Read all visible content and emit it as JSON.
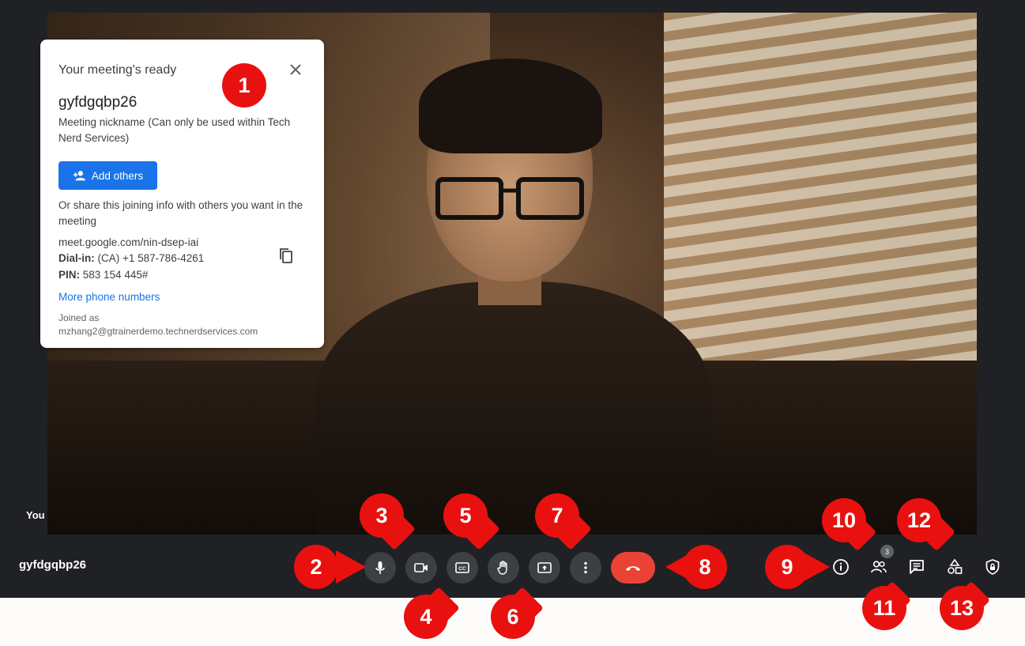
{
  "video": {
    "self_label": "You"
  },
  "meeting_card": {
    "title": "Your meeting's ready",
    "code": "gyfdgqbp26",
    "nickname_note": "Meeting nickname (Can only be used within Tech Nerd Services)",
    "add_others_label": "Add others",
    "share_text": "Or share this joining info with others you want in the meeting",
    "meeting_link": "meet.google.com/nin-dsep-iai",
    "dial_in_label": "Dial-in:",
    "dial_in_value": "(CA) +1 587-786-4261",
    "pin_label": "PIN:",
    "pin_value": "583 154 445#",
    "more_numbers_label": "More phone numbers",
    "joined_as_label": "Joined as",
    "joined_as_email": "mzhang2@gtrainerdemo.technerdservices.com"
  },
  "bottom_bar": {
    "meeting_code": "gyfdgqbp26",
    "participant_count": "3"
  },
  "callouts": [
    "1",
    "2",
    "3",
    "4",
    "5",
    "6",
    "7",
    "8",
    "9",
    "10",
    "11",
    "12",
    "13"
  ],
  "colors": {
    "callout": "#e8110f",
    "hangup": "#ea4335",
    "button": "#3c4043",
    "accent": "#1a73e8"
  }
}
